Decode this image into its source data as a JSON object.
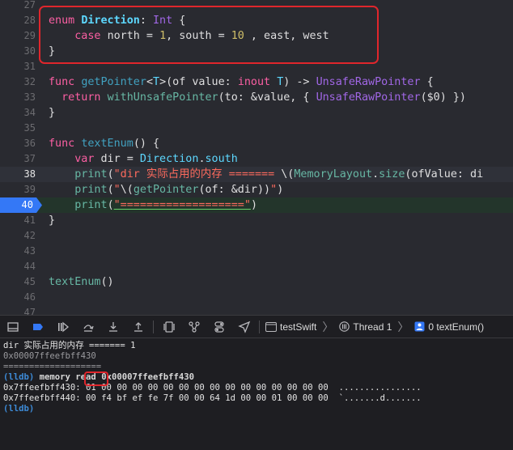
{
  "editor": {
    "lines": [
      {
        "n": "27",
        "tokens": []
      },
      {
        "n": "28",
        "tokens": [
          [
            "kw",
            "enum "
          ],
          [
            "tyb",
            "Direction"
          ],
          [
            "",
            ": "
          ],
          [
            "pl",
            "Int"
          ],
          [
            "",
            " {"
          ]
        ]
      },
      {
        "n": "29",
        "tokens": [
          [
            "",
            "    "
          ],
          [
            "kw",
            "case "
          ],
          [
            "",
            "north = "
          ],
          [
            "num",
            "1"
          ],
          [
            "",
            ", south = "
          ],
          [
            "num",
            "10"
          ],
          [
            "",
            " , east, west"
          ]
        ]
      },
      {
        "n": "30",
        "tokens": [
          [
            "",
            "}"
          ]
        ]
      },
      {
        "n": "31",
        "tokens": []
      },
      {
        "n": "32",
        "tokens": [
          [
            "kw",
            "func "
          ],
          [
            "fn",
            "getPointer"
          ],
          [
            "",
            "<"
          ],
          [
            "ty",
            "T"
          ],
          [
            "",
            ">(of value: "
          ],
          [
            "kw",
            "inout "
          ],
          [
            "ty",
            "T"
          ],
          [
            "",
            ") -> "
          ],
          [
            "pl",
            "UnsafeRawPointer"
          ],
          [
            "",
            " {"
          ]
        ]
      },
      {
        "n": "33",
        "tokens": [
          [
            "",
            "  "
          ],
          [
            "kw",
            "return "
          ],
          [
            "pf",
            "withUnsafePointer"
          ],
          [
            "",
            "(to: &value, { "
          ],
          [
            "pl",
            "UnsafeRawPointer"
          ],
          [
            "",
            "($0) })"
          ]
        ]
      },
      {
        "n": "34",
        "tokens": [
          [
            "",
            "}"
          ]
        ]
      },
      {
        "n": "35",
        "tokens": []
      },
      {
        "n": "36",
        "tokens": [
          [
            "kw",
            "func "
          ],
          [
            "fn",
            "textEnum"
          ],
          [
            "",
            "() {"
          ]
        ]
      },
      {
        "n": "37",
        "tokens": [
          [
            "",
            "    "
          ],
          [
            "kw",
            "var "
          ],
          [
            "",
            "dir = "
          ],
          [
            "ty",
            "Direction"
          ],
          [
            "",
            "."
          ],
          [
            "ty",
            "south"
          ]
        ]
      },
      {
        "n": "38",
        "tokens": [
          [
            "",
            "    "
          ],
          [
            "pf",
            "print"
          ],
          [
            "",
            "("
          ],
          [
            "str",
            "\"dir 实际占用的内存 ======= "
          ],
          [
            "",
            "\\("
          ],
          [
            "pf",
            "MemoryLayout"
          ],
          [
            "",
            "."
          ],
          [
            "pf",
            "size"
          ],
          [
            "",
            "(ofValue: di"
          ]
        ]
      },
      {
        "n": "39",
        "tokens": [
          [
            "",
            "    "
          ],
          [
            "pf",
            "print"
          ],
          [
            "",
            "("
          ],
          [
            "str",
            "\""
          ],
          [
            "",
            "\\("
          ],
          [
            "pf",
            "getPointer"
          ],
          [
            "",
            "(of: &dir))"
          ],
          [
            "str",
            "\""
          ],
          [
            "",
            ")"
          ]
        ]
      },
      {
        "n": "40",
        "tokens": [
          [
            "",
            "    "
          ],
          [
            "pf",
            "print"
          ],
          [
            "",
            "("
          ],
          [
            "str",
            "\"===================\""
          ],
          [
            "",
            ")"
          ]
        ]
      },
      {
        "n": "41",
        "tokens": [
          [
            "",
            "}"
          ]
        ]
      },
      {
        "n": "42",
        "tokens": []
      },
      {
        "n": "43",
        "tokens": []
      },
      {
        "n": "44",
        "tokens": []
      },
      {
        "n": "45",
        "tokens": [
          [
            "pf",
            "textEnum"
          ],
          [
            "",
            "()"
          ]
        ]
      },
      {
        "n": "46",
        "tokens": []
      },
      {
        "n": "47",
        "tokens": []
      }
    ]
  },
  "toolbar": {
    "target": "testSwift",
    "thread": "Thread 1",
    "frame": "0 textEnum()"
  },
  "console": {
    "lines": [
      {
        "style": "",
        "text": "dir 实际占用的内存 ======= 1"
      },
      {
        "style": "dim",
        "text": "0x00007ffeefbff430"
      },
      {
        "style": "dim",
        "text": "==================="
      },
      {
        "style": "lldb",
        "prompt": "(lldb) ",
        "text": "memory read 0x00007ffeefbff430"
      },
      {
        "style": "",
        "text": "0x7ffeefbff430: 01 00 00 00 00 00 00 00 00 00 00 00 00 00 00 00  ................"
      },
      {
        "style": "",
        "text": "0x7ffeefbff440: 00 f4 bf ef fe 7f 00 00 64 1d 00 00 01 00 00 00  `.......d......."
      },
      {
        "style": "lldb",
        "prompt": "(lldb)",
        "text": ""
      }
    ]
  },
  "colors": {
    "accent_breakpoint": "#3478f6",
    "annotation_red": "#e0262c"
  }
}
